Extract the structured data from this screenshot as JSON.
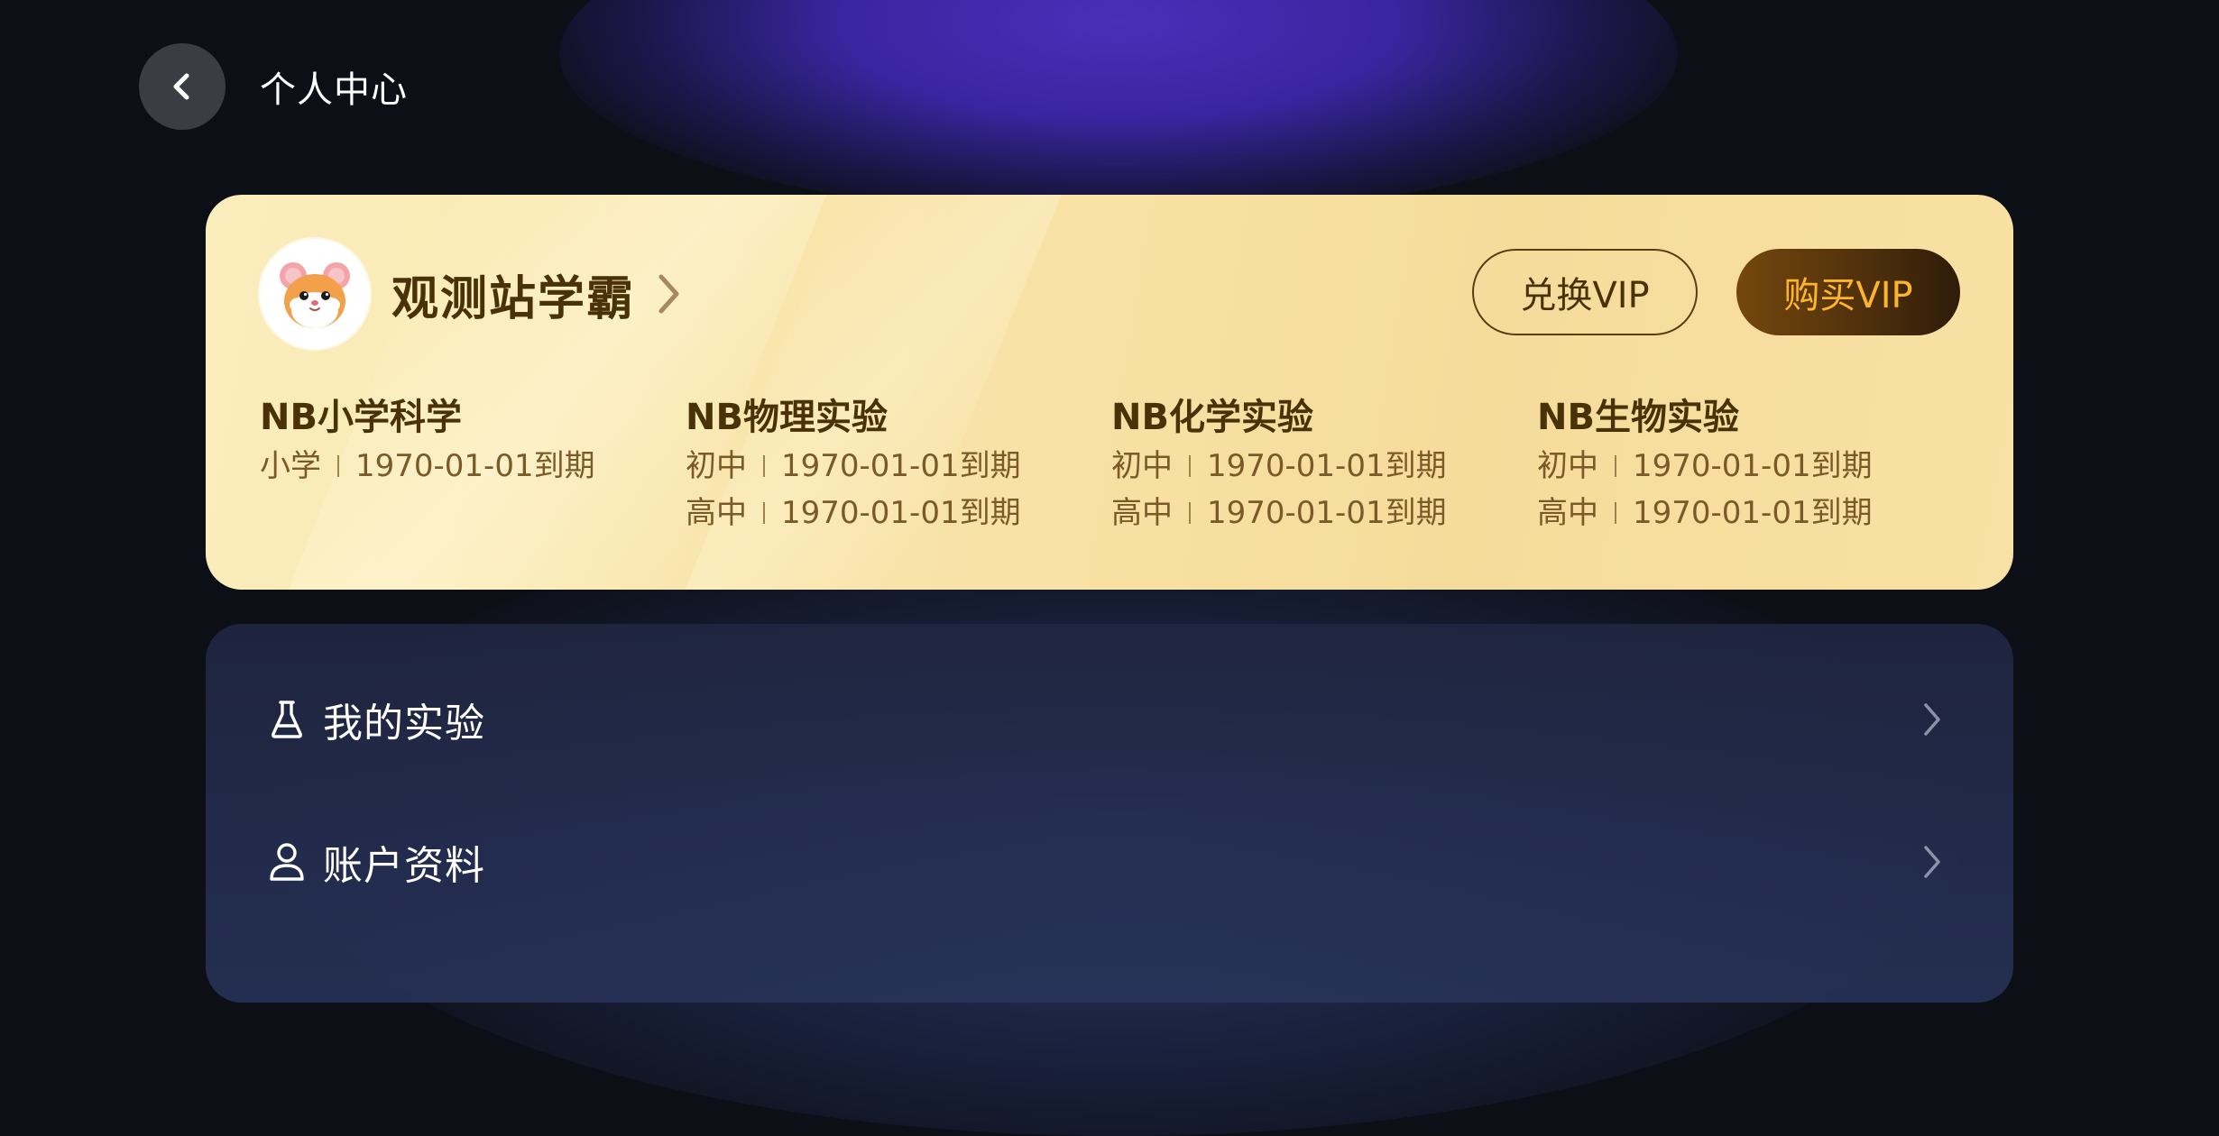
{
  "header": {
    "title": "个人中心"
  },
  "user": {
    "name": "观测站学霸",
    "avatar_emoji": "🐹"
  },
  "buttons": {
    "redeem_vip": "兑换VIP",
    "buy_vip": "购买VIP"
  },
  "subjects": [
    {
      "name": "NB小学科学",
      "levels": [
        {
          "level": "小学",
          "expiry": "1970-01-01到期"
        }
      ]
    },
    {
      "name": "NB物理实验",
      "levels": [
        {
          "level": "初中",
          "expiry": "1970-01-01到期"
        },
        {
          "level": "高中",
          "expiry": "1970-01-01到期"
        }
      ]
    },
    {
      "name": "NB化学实验",
      "levels": [
        {
          "level": "初中",
          "expiry": "1970-01-01到期"
        },
        {
          "level": "高中",
          "expiry": "1970-01-01到期"
        }
      ]
    },
    {
      "name": "NB生物实验",
      "levels": [
        {
          "level": "初中",
          "expiry": "1970-01-01到期"
        },
        {
          "level": "高中",
          "expiry": "1970-01-01到期"
        }
      ]
    }
  ],
  "menu": [
    {
      "label": "我的实验",
      "icon": "flask-icon"
    },
    {
      "label": "账户资料",
      "icon": "user-icon"
    }
  ],
  "colors": {
    "background": "#0d0f16",
    "card_gold": "#f8e2a6",
    "text_brown": "#4a3208",
    "buy_button_text": "#ffb52a",
    "menu_panel": "#242e52"
  }
}
